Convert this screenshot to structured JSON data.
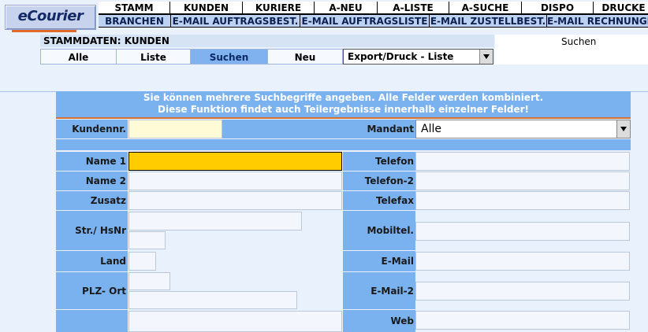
{
  "logo": {
    "text": "eCourier"
  },
  "nav_main": [
    "STAMM",
    "KUNDEN",
    "KURIERE",
    "A-NEU",
    "A-LISTE",
    "A-SUCHE",
    "DISPO",
    "DRUCKE"
  ],
  "nav_sub": [
    "BRANCHEN",
    "E-MAIL AUFTRAGSBEST.",
    "E-MAIL AUFTRAGSLISTE",
    "E-MAIL ZUSTELLBEST.",
    "E-MAIL RECHNUNGE"
  ],
  "stammdaten_title": "STAMMDATEN: KUNDEN",
  "top_right_label": "Suchen",
  "tabs": [
    "Alle",
    "Liste",
    "Suchen",
    "Neu"
  ],
  "export_select": {
    "selected": "Export/Druck - Liste"
  },
  "banner": {
    "line1": "Sie können mehrere Suchbegriffe angeben. Alle Felder werden kombiniert.",
    "line2": "Diese Funktion findet auch Teilergebnisse innerhalb einzelner Felder!"
  },
  "form": {
    "kundennr": "Kundennr.",
    "mandant": "Mandant",
    "mandant_value": "Alle",
    "name1": "Name 1",
    "name2": "Name 2",
    "zusatz": "Zusatz",
    "str": "Str./ HsNr",
    "land": "Land",
    "plz": "PLZ- Ort",
    "telefon": "Telefon",
    "telefon2": "Telefon-2",
    "telefax": "Telefax",
    "mobil": "Mobiltel.",
    "email": "E-Mail",
    "email2": "E-Mail-2",
    "web": "Web"
  },
  "colors": {
    "accent": "#7ab1ef",
    "focused_field": "#ffcc00",
    "underline": "#d4702f"
  }
}
